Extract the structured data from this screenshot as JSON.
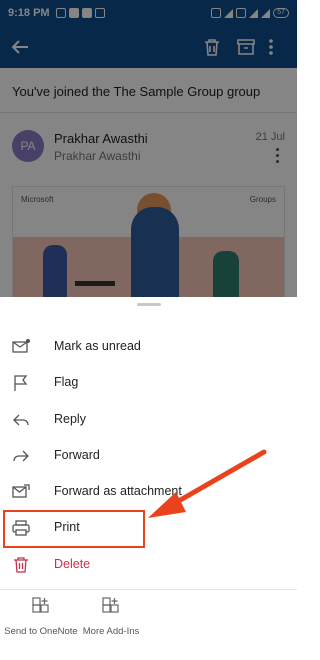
{
  "statusbar": {
    "time": "9:18 PM",
    "battery": "57"
  },
  "email": {
    "subject": "You've joined the The Sample Group group",
    "sender_initials": "PA",
    "sender_name": "Prakhar Awasthi",
    "sender_sub": "Prakhar Awasthi",
    "date": "21 Jul",
    "banner_brand": "Microsoft",
    "banner_product": "Groups"
  },
  "menu": {
    "items": [
      {
        "label": "Mark as unread",
        "icon": "mail-unread-icon"
      },
      {
        "label": "Flag",
        "icon": "flag-icon"
      },
      {
        "label": "Reply",
        "icon": "reply-icon"
      },
      {
        "label": "Forward",
        "icon": "forward-icon"
      },
      {
        "label": "Forward as attachment",
        "icon": "forward-attachment-icon"
      },
      {
        "label": "Print",
        "icon": "printer-icon"
      },
      {
        "label": "Delete",
        "icon": "trash-icon"
      }
    ]
  },
  "addins": [
    {
      "label": "Send to OneNote",
      "icon": "add-in-icon"
    },
    {
      "label": "More Add-Ins",
      "icon": "add-in-icon"
    }
  ],
  "colors": {
    "appbar": "#0f4d8c",
    "highlight": "#e8431c",
    "delete": "#c4314b"
  }
}
